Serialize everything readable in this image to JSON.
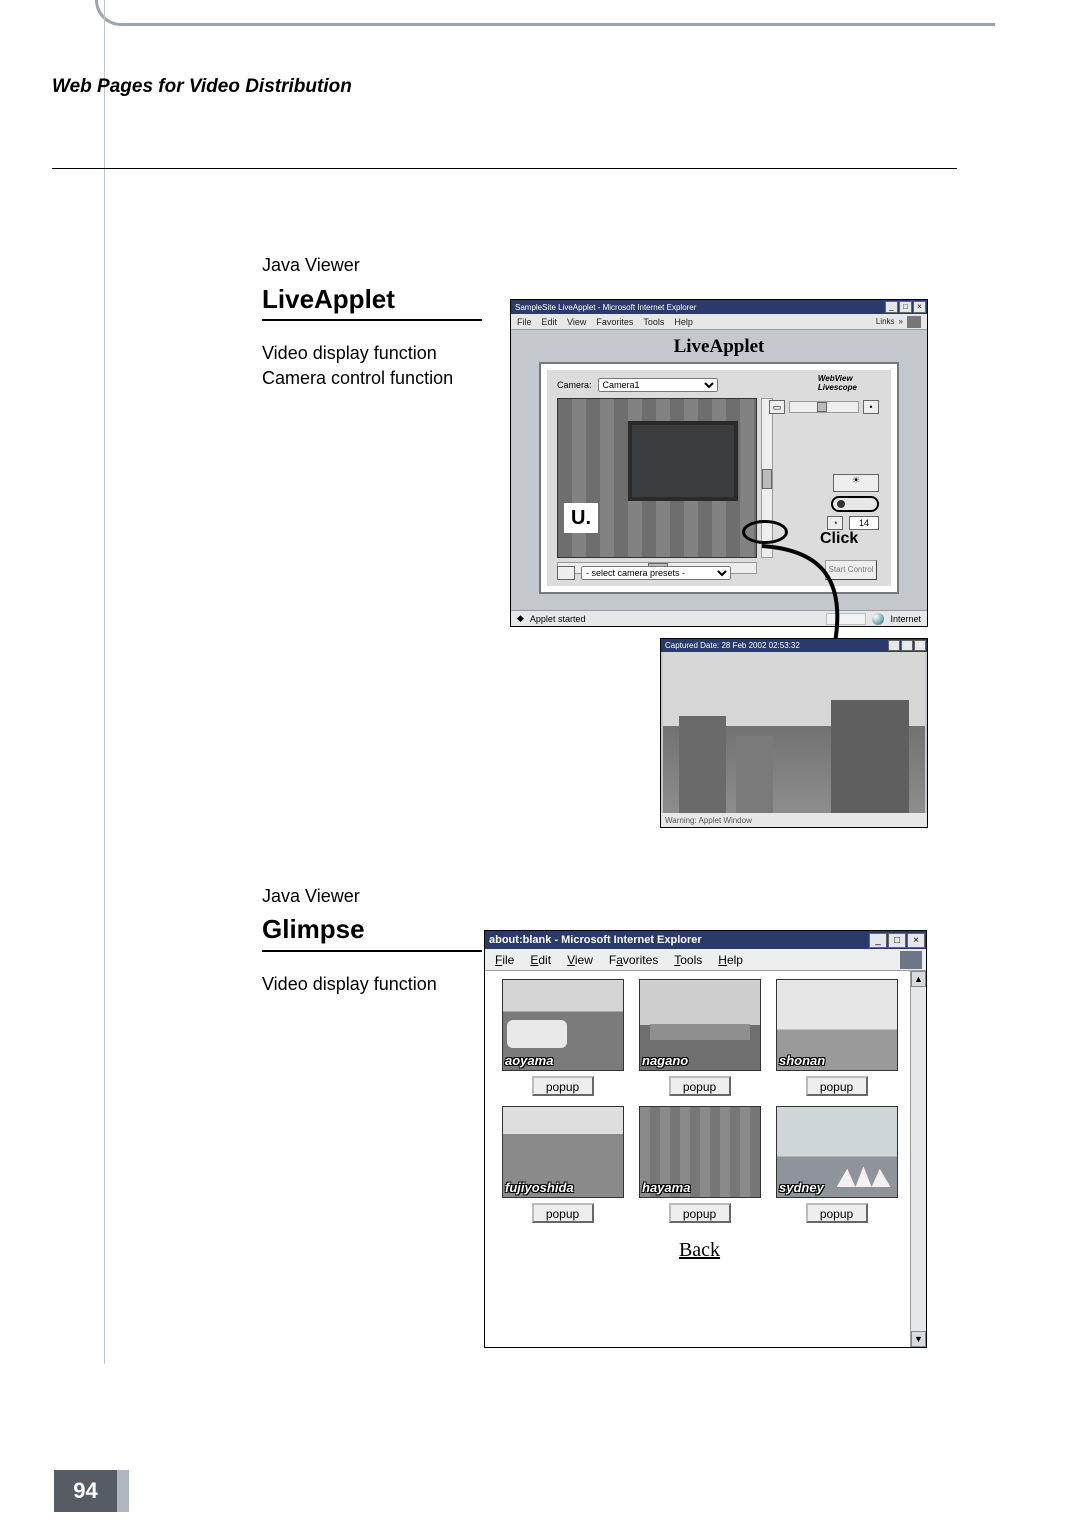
{
  "page": {
    "running_head": "Web Pages for Video Distribution",
    "number": "94"
  },
  "section1": {
    "preheading": "Java Viewer",
    "heading": "LiveApplet",
    "line1": "Video display function",
    "line2": "Camera control function",
    "click_label": "Click"
  },
  "fig1": {
    "window_title": "SampleSite LiveApplet - Microsoft Internet Explorer",
    "menu": {
      "file": "File",
      "edit": "Edit",
      "view": "View",
      "favorites": "Favorites",
      "tools": "Tools",
      "help": "Help",
      "links": "Links"
    },
    "inner_title": "LiveApplet",
    "camera_label": "Camera:",
    "camera_selected": "Camera1",
    "webview_label": "WebView\nLivescope",
    "number_readout": "14",
    "preset_placeholder": "- select camera presets -",
    "start_btn": "Start Control",
    "status_left": "Applet started",
    "status_right": "Internet"
  },
  "fig1b": {
    "title": "Captured Date: 28 Feb 2002 02:53:32",
    "footer": "Warning: Applet Window"
  },
  "section2": {
    "preheading": "Java Viewer",
    "heading": "Glimpse",
    "line1": "Video display function"
  },
  "fig2": {
    "window_title": "about:blank - Microsoft Internet Explorer",
    "menu": {
      "file": "File",
      "edit": "Edit",
      "view": "View",
      "favorites": "Favorites",
      "tools": "Tools",
      "help": "Help"
    },
    "popup_label": "popup",
    "back_label": "Back",
    "thumbs": [
      {
        "name": "aoyama"
      },
      {
        "name": "nagano"
      },
      {
        "name": "shonan"
      },
      {
        "name": "fujiyoshida"
      },
      {
        "name": "hayama"
      },
      {
        "name": "sydney"
      }
    ]
  }
}
